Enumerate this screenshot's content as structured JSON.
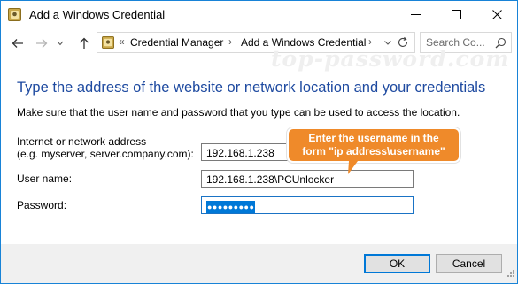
{
  "window": {
    "title": "Add a Windows Credential",
    "icon": "credential-manager-icon",
    "border_color": "#1883d7"
  },
  "nav": {
    "back": "back-arrow-icon",
    "forward": "forward-arrow-icon",
    "up": "up-arrow-icon",
    "breadcrumb_prefix": "«",
    "breadcrumbs": [
      "Credential Manager",
      "Add a Windows Credential"
    ],
    "separator": "›",
    "search_placeholder": "Search Co..."
  },
  "watermark": "top-password.com",
  "main": {
    "heading": "Type the address of the website or network location and your credentials",
    "heading_color": "#1e4aa0",
    "subtext": "Make sure that the user name and password that you type can be used to access the location.",
    "address_label_line1": "Internet or network address",
    "address_label_line2": "(e.g. myserver, server.company.com):",
    "address_value": "192.168.1.238",
    "username_label": "User name:",
    "username_value": "192.168.1.238\\PCUnlocker",
    "password_label": "Password:",
    "password_masked": "●●●●●●●●●"
  },
  "callout": {
    "line1": "Enter the username in the",
    "line2": "form \"ip address\\username\"",
    "color": "#ef8a2a"
  },
  "footer": {
    "ok_label": "OK",
    "cancel_label": "Cancel",
    "accent": "#0078d7"
  }
}
